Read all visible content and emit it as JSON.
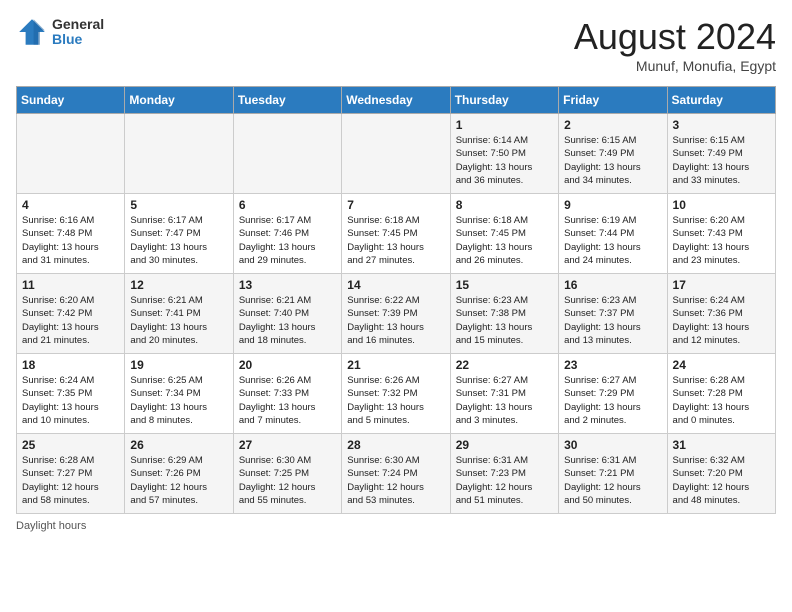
{
  "header": {
    "logo_general": "General",
    "logo_blue": "Blue",
    "month_year": "August 2024",
    "location": "Munuf, Monufia, Egypt"
  },
  "days_of_week": [
    "Sunday",
    "Monday",
    "Tuesday",
    "Wednesday",
    "Thursday",
    "Friday",
    "Saturday"
  ],
  "weeks": [
    [
      {
        "day": "",
        "info": ""
      },
      {
        "day": "",
        "info": ""
      },
      {
        "day": "",
        "info": ""
      },
      {
        "day": "",
        "info": ""
      },
      {
        "day": "1",
        "info": "Sunrise: 6:14 AM\nSunset: 7:50 PM\nDaylight: 13 hours\nand 36 minutes."
      },
      {
        "day": "2",
        "info": "Sunrise: 6:15 AM\nSunset: 7:49 PM\nDaylight: 13 hours\nand 34 minutes."
      },
      {
        "day": "3",
        "info": "Sunrise: 6:15 AM\nSunset: 7:49 PM\nDaylight: 13 hours\nand 33 minutes."
      }
    ],
    [
      {
        "day": "4",
        "info": "Sunrise: 6:16 AM\nSunset: 7:48 PM\nDaylight: 13 hours\nand 31 minutes."
      },
      {
        "day": "5",
        "info": "Sunrise: 6:17 AM\nSunset: 7:47 PM\nDaylight: 13 hours\nand 30 minutes."
      },
      {
        "day": "6",
        "info": "Sunrise: 6:17 AM\nSunset: 7:46 PM\nDaylight: 13 hours\nand 29 minutes."
      },
      {
        "day": "7",
        "info": "Sunrise: 6:18 AM\nSunset: 7:45 PM\nDaylight: 13 hours\nand 27 minutes."
      },
      {
        "day": "8",
        "info": "Sunrise: 6:18 AM\nSunset: 7:45 PM\nDaylight: 13 hours\nand 26 minutes."
      },
      {
        "day": "9",
        "info": "Sunrise: 6:19 AM\nSunset: 7:44 PM\nDaylight: 13 hours\nand 24 minutes."
      },
      {
        "day": "10",
        "info": "Sunrise: 6:20 AM\nSunset: 7:43 PM\nDaylight: 13 hours\nand 23 minutes."
      }
    ],
    [
      {
        "day": "11",
        "info": "Sunrise: 6:20 AM\nSunset: 7:42 PM\nDaylight: 13 hours\nand 21 minutes."
      },
      {
        "day": "12",
        "info": "Sunrise: 6:21 AM\nSunset: 7:41 PM\nDaylight: 13 hours\nand 20 minutes."
      },
      {
        "day": "13",
        "info": "Sunrise: 6:21 AM\nSunset: 7:40 PM\nDaylight: 13 hours\nand 18 minutes."
      },
      {
        "day": "14",
        "info": "Sunrise: 6:22 AM\nSunset: 7:39 PM\nDaylight: 13 hours\nand 16 minutes."
      },
      {
        "day": "15",
        "info": "Sunrise: 6:23 AM\nSunset: 7:38 PM\nDaylight: 13 hours\nand 15 minutes."
      },
      {
        "day": "16",
        "info": "Sunrise: 6:23 AM\nSunset: 7:37 PM\nDaylight: 13 hours\nand 13 minutes."
      },
      {
        "day": "17",
        "info": "Sunrise: 6:24 AM\nSunset: 7:36 PM\nDaylight: 13 hours\nand 12 minutes."
      }
    ],
    [
      {
        "day": "18",
        "info": "Sunrise: 6:24 AM\nSunset: 7:35 PM\nDaylight: 13 hours\nand 10 minutes."
      },
      {
        "day": "19",
        "info": "Sunrise: 6:25 AM\nSunset: 7:34 PM\nDaylight: 13 hours\nand 8 minutes."
      },
      {
        "day": "20",
        "info": "Sunrise: 6:26 AM\nSunset: 7:33 PM\nDaylight: 13 hours\nand 7 minutes."
      },
      {
        "day": "21",
        "info": "Sunrise: 6:26 AM\nSunset: 7:32 PM\nDaylight: 13 hours\nand 5 minutes."
      },
      {
        "day": "22",
        "info": "Sunrise: 6:27 AM\nSunset: 7:31 PM\nDaylight: 13 hours\nand 3 minutes."
      },
      {
        "day": "23",
        "info": "Sunrise: 6:27 AM\nSunset: 7:29 PM\nDaylight: 13 hours\nand 2 minutes."
      },
      {
        "day": "24",
        "info": "Sunrise: 6:28 AM\nSunset: 7:28 PM\nDaylight: 13 hours\nand 0 minutes."
      }
    ],
    [
      {
        "day": "25",
        "info": "Sunrise: 6:28 AM\nSunset: 7:27 PM\nDaylight: 12 hours\nand 58 minutes."
      },
      {
        "day": "26",
        "info": "Sunrise: 6:29 AM\nSunset: 7:26 PM\nDaylight: 12 hours\nand 57 minutes."
      },
      {
        "day": "27",
        "info": "Sunrise: 6:30 AM\nSunset: 7:25 PM\nDaylight: 12 hours\nand 55 minutes."
      },
      {
        "day": "28",
        "info": "Sunrise: 6:30 AM\nSunset: 7:24 PM\nDaylight: 12 hours\nand 53 minutes."
      },
      {
        "day": "29",
        "info": "Sunrise: 6:31 AM\nSunset: 7:23 PM\nDaylight: 12 hours\nand 51 minutes."
      },
      {
        "day": "30",
        "info": "Sunrise: 6:31 AM\nSunset: 7:21 PM\nDaylight: 12 hours\nand 50 minutes."
      },
      {
        "day": "31",
        "info": "Sunrise: 6:32 AM\nSunset: 7:20 PM\nDaylight: 12 hours\nand 48 minutes."
      }
    ]
  ],
  "footer": {
    "daylight_hours": "Daylight hours"
  }
}
